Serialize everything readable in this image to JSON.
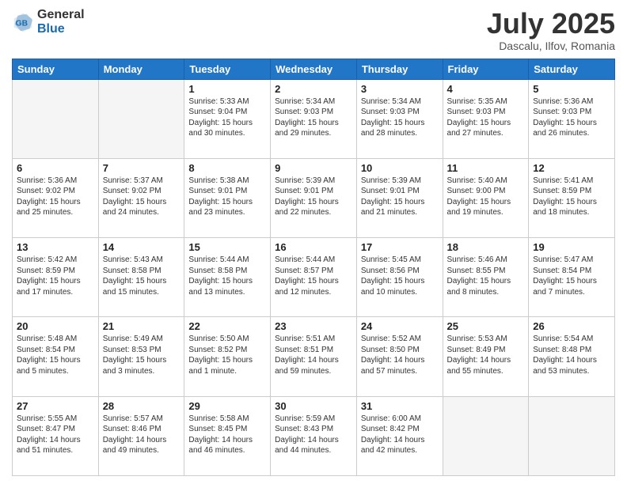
{
  "logo": {
    "general": "General",
    "blue": "Blue"
  },
  "title": "July 2025",
  "subtitle": "Dascalu, Ilfov, Romania",
  "headers": [
    "Sunday",
    "Monday",
    "Tuesday",
    "Wednesday",
    "Thursday",
    "Friday",
    "Saturday"
  ],
  "weeks": [
    [
      {
        "day": "",
        "info": ""
      },
      {
        "day": "",
        "info": ""
      },
      {
        "day": "1",
        "info": "Sunrise: 5:33 AM\nSunset: 9:04 PM\nDaylight: 15 hours\nand 30 minutes."
      },
      {
        "day": "2",
        "info": "Sunrise: 5:34 AM\nSunset: 9:03 PM\nDaylight: 15 hours\nand 29 minutes."
      },
      {
        "day": "3",
        "info": "Sunrise: 5:34 AM\nSunset: 9:03 PM\nDaylight: 15 hours\nand 28 minutes."
      },
      {
        "day": "4",
        "info": "Sunrise: 5:35 AM\nSunset: 9:03 PM\nDaylight: 15 hours\nand 27 minutes."
      },
      {
        "day": "5",
        "info": "Sunrise: 5:36 AM\nSunset: 9:03 PM\nDaylight: 15 hours\nand 26 minutes."
      }
    ],
    [
      {
        "day": "6",
        "info": "Sunrise: 5:36 AM\nSunset: 9:02 PM\nDaylight: 15 hours\nand 25 minutes."
      },
      {
        "day": "7",
        "info": "Sunrise: 5:37 AM\nSunset: 9:02 PM\nDaylight: 15 hours\nand 24 minutes."
      },
      {
        "day": "8",
        "info": "Sunrise: 5:38 AM\nSunset: 9:01 PM\nDaylight: 15 hours\nand 23 minutes."
      },
      {
        "day": "9",
        "info": "Sunrise: 5:39 AM\nSunset: 9:01 PM\nDaylight: 15 hours\nand 22 minutes."
      },
      {
        "day": "10",
        "info": "Sunrise: 5:39 AM\nSunset: 9:01 PM\nDaylight: 15 hours\nand 21 minutes."
      },
      {
        "day": "11",
        "info": "Sunrise: 5:40 AM\nSunset: 9:00 PM\nDaylight: 15 hours\nand 19 minutes."
      },
      {
        "day": "12",
        "info": "Sunrise: 5:41 AM\nSunset: 8:59 PM\nDaylight: 15 hours\nand 18 minutes."
      }
    ],
    [
      {
        "day": "13",
        "info": "Sunrise: 5:42 AM\nSunset: 8:59 PM\nDaylight: 15 hours\nand 17 minutes."
      },
      {
        "day": "14",
        "info": "Sunrise: 5:43 AM\nSunset: 8:58 PM\nDaylight: 15 hours\nand 15 minutes."
      },
      {
        "day": "15",
        "info": "Sunrise: 5:44 AM\nSunset: 8:58 PM\nDaylight: 15 hours\nand 13 minutes."
      },
      {
        "day": "16",
        "info": "Sunrise: 5:44 AM\nSunset: 8:57 PM\nDaylight: 15 hours\nand 12 minutes."
      },
      {
        "day": "17",
        "info": "Sunrise: 5:45 AM\nSunset: 8:56 PM\nDaylight: 15 hours\nand 10 minutes."
      },
      {
        "day": "18",
        "info": "Sunrise: 5:46 AM\nSunset: 8:55 PM\nDaylight: 15 hours\nand 8 minutes."
      },
      {
        "day": "19",
        "info": "Sunrise: 5:47 AM\nSunset: 8:54 PM\nDaylight: 15 hours\nand 7 minutes."
      }
    ],
    [
      {
        "day": "20",
        "info": "Sunrise: 5:48 AM\nSunset: 8:54 PM\nDaylight: 15 hours\nand 5 minutes."
      },
      {
        "day": "21",
        "info": "Sunrise: 5:49 AM\nSunset: 8:53 PM\nDaylight: 15 hours\nand 3 minutes."
      },
      {
        "day": "22",
        "info": "Sunrise: 5:50 AM\nSunset: 8:52 PM\nDaylight: 15 hours\nand 1 minute."
      },
      {
        "day": "23",
        "info": "Sunrise: 5:51 AM\nSunset: 8:51 PM\nDaylight: 14 hours\nand 59 minutes."
      },
      {
        "day": "24",
        "info": "Sunrise: 5:52 AM\nSunset: 8:50 PM\nDaylight: 14 hours\nand 57 minutes."
      },
      {
        "day": "25",
        "info": "Sunrise: 5:53 AM\nSunset: 8:49 PM\nDaylight: 14 hours\nand 55 minutes."
      },
      {
        "day": "26",
        "info": "Sunrise: 5:54 AM\nSunset: 8:48 PM\nDaylight: 14 hours\nand 53 minutes."
      }
    ],
    [
      {
        "day": "27",
        "info": "Sunrise: 5:55 AM\nSunset: 8:47 PM\nDaylight: 14 hours\nand 51 minutes."
      },
      {
        "day": "28",
        "info": "Sunrise: 5:57 AM\nSunset: 8:46 PM\nDaylight: 14 hours\nand 49 minutes."
      },
      {
        "day": "29",
        "info": "Sunrise: 5:58 AM\nSunset: 8:45 PM\nDaylight: 14 hours\nand 46 minutes."
      },
      {
        "day": "30",
        "info": "Sunrise: 5:59 AM\nSunset: 8:43 PM\nDaylight: 14 hours\nand 44 minutes."
      },
      {
        "day": "31",
        "info": "Sunrise: 6:00 AM\nSunset: 8:42 PM\nDaylight: 14 hours\nand 42 minutes."
      },
      {
        "day": "",
        "info": ""
      },
      {
        "day": "",
        "info": ""
      }
    ]
  ]
}
